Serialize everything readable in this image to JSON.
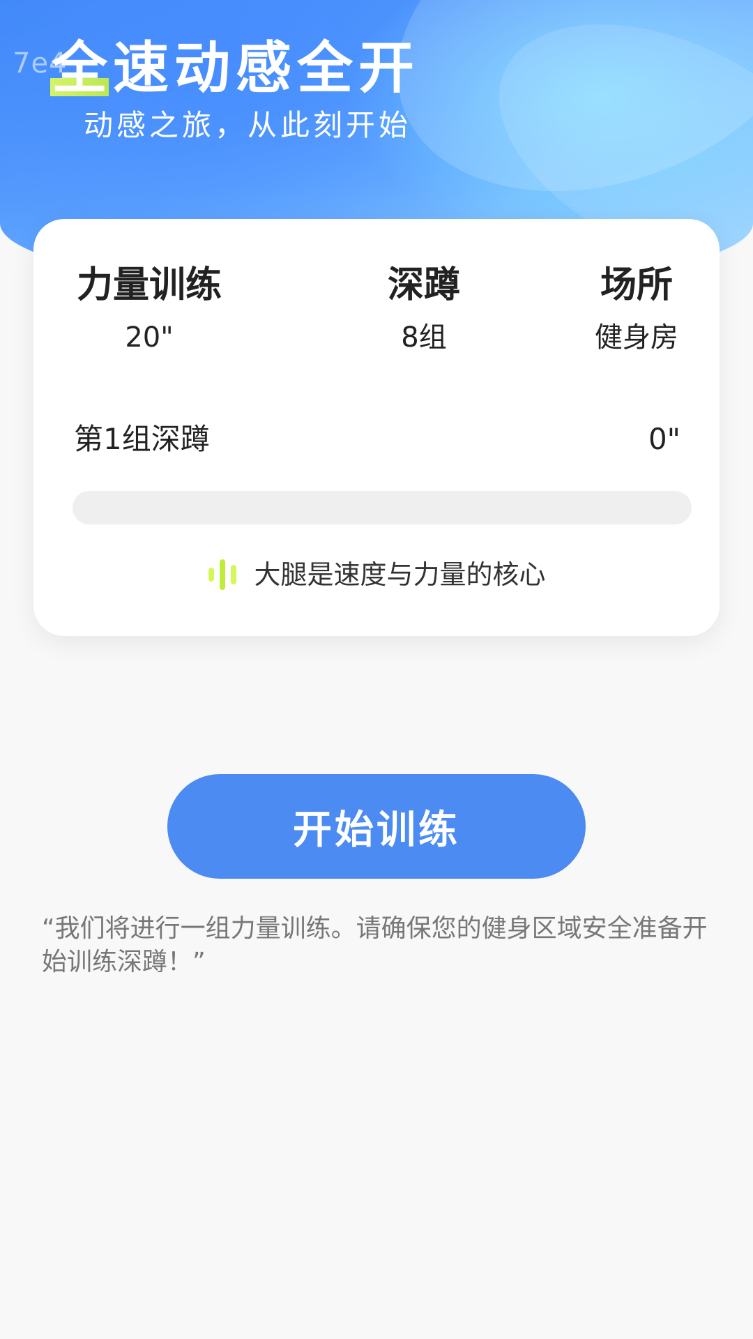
{
  "hero": {
    "title": "全速动感全开",
    "subtitle": "动感之旅，从此刻开始",
    "watermark": "7e4"
  },
  "card": {
    "stats": [
      {
        "label": "力量训练",
        "value": "20\""
      },
      {
        "label": "深蹲",
        "value": "8组"
      },
      {
        "label": "场所",
        "value": "健身房"
      }
    ],
    "current_set": {
      "label": "第1组深蹲",
      "time": "0\""
    },
    "progress": 0,
    "tip": {
      "icon": "sound-wave-icon",
      "text": "大腿是速度与力量的核心"
    }
  },
  "actions": {
    "start_label": "开始训练"
  },
  "note": "“我们将进行一组力量训练。请确保您的健身区域安全准备开始训练深蹲！”",
  "colors": {
    "primary": "#4b8bf2",
    "accent": "#c8f240",
    "background": "#f8f8f8"
  }
}
